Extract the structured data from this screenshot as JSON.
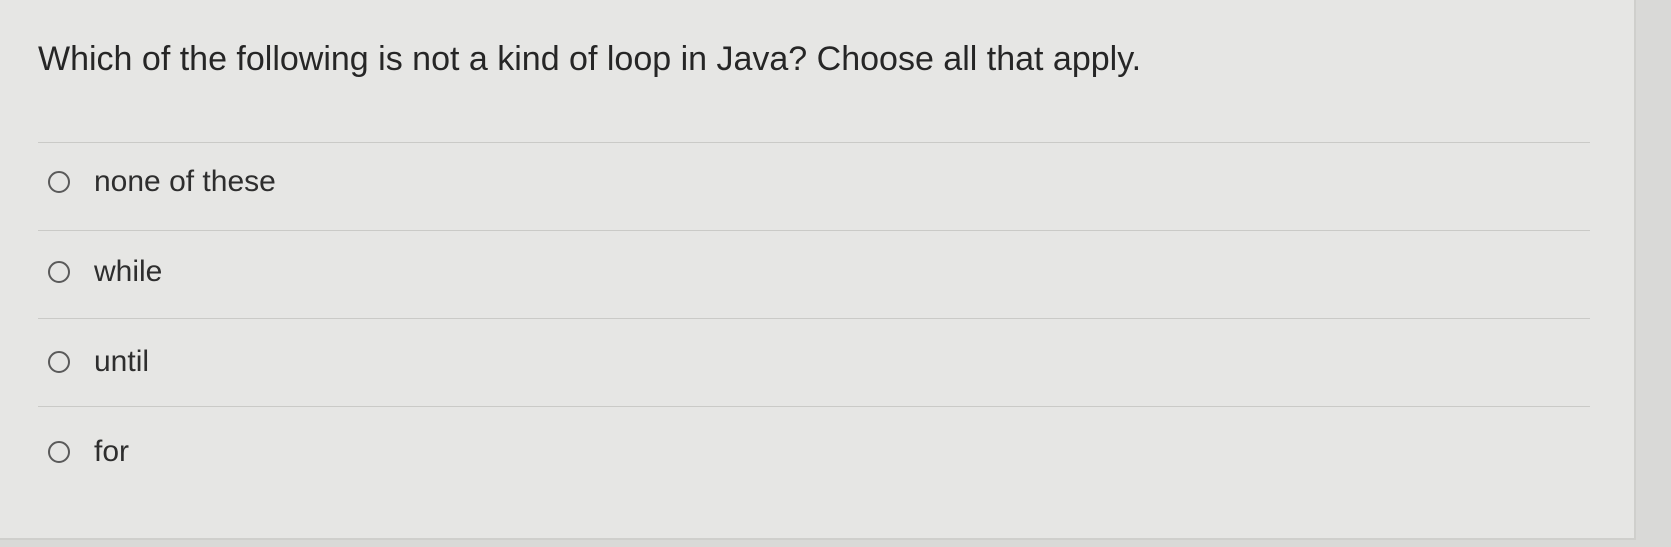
{
  "question": {
    "text": "Which of the following is not a kind of loop in Java? Choose all that apply."
  },
  "options": [
    {
      "label": "none of these",
      "selected": false
    },
    {
      "label": "while",
      "selected": false
    },
    {
      "label": "until",
      "selected": false
    },
    {
      "label": "for",
      "selected": false
    }
  ],
  "colors": {
    "background": "#e6e6e4",
    "text": "#262626",
    "divider": "#cacac7",
    "radio_border": "#5a5a5a"
  }
}
